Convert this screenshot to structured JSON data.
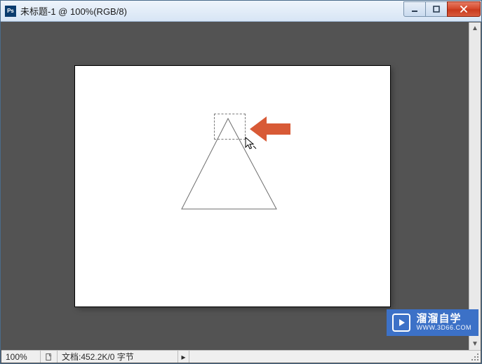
{
  "window": {
    "title": "未标题-1 @ 100%(RGB/8)"
  },
  "statusbar": {
    "zoom": "100%",
    "doc_info": "文档:452.2K/0 字节",
    "expand_glyph": "▸"
  },
  "watermark": {
    "brand": "溜溜自学",
    "url": "WWW.3D66.COM"
  },
  "scrollbar": {
    "up_glyph": "▲",
    "down_glyph": "▼"
  },
  "colors": {
    "arrow": "#d85a36",
    "brand_bg": "#3c71c7"
  }
}
